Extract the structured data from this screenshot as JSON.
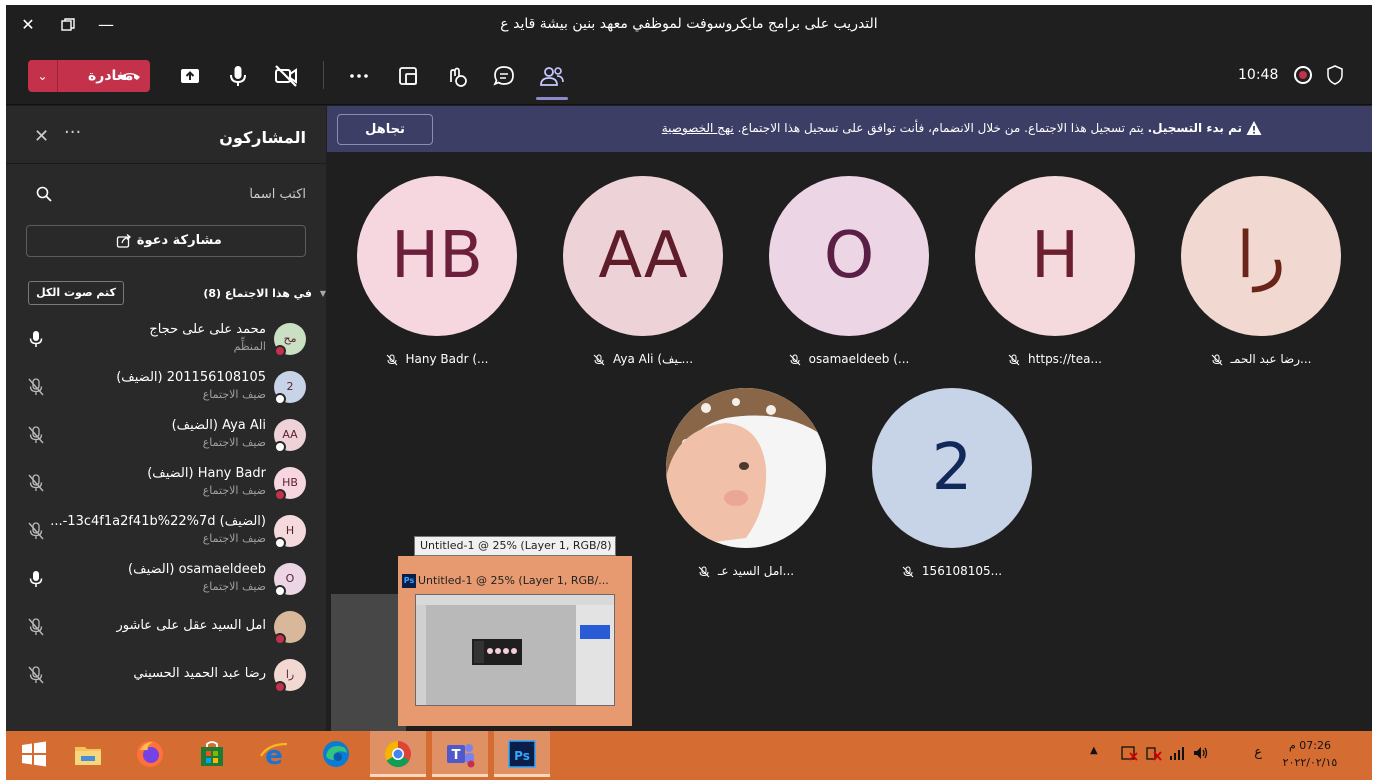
{
  "window": {
    "title": "التدريب على برامج مايكروسوفت لموظفي معهد بنين بيشة قايد ع"
  },
  "toolbar": {
    "leave_label": "مغادرة",
    "time": "10:48"
  },
  "panel": {
    "title": "المشاركون",
    "search_placeholder": "اكتب اسماً",
    "invite_label": "مشاركة دعوة",
    "section_label": "في هذا الاجتماع (8)",
    "mute_all_label": "كتم صوت الكل",
    "participants": [
      {
        "name": "محمد على على حجاج",
        "role": "المنظِّم",
        "initials": "مح",
        "avatar_color": "#c9e0c2",
        "presence": "busy",
        "mic": "on"
      },
      {
        "name": "201156108105 (الضيف)",
        "role": "ضيف الاجتماع",
        "initials": "2",
        "avatar_color": "#c7d3e6",
        "presence": "available",
        "mic": "off"
      },
      {
        "name": "Aya Ali (الضيف)",
        "role": "ضيف الاجتماع",
        "initials": "AA",
        "avatar_color": "#edd3d8",
        "presence": "available",
        "mic": "off"
      },
      {
        "name": "Hany Badr (الضيف)",
        "role": "ضيف الاجتماع",
        "initials": "HB",
        "avatar_color": "#f6d7e0",
        "presence": "busy",
        "mic": "off"
      },
      {
        "name": "(الضيف) 13c4f1a2f41b%22%7d-...",
        "role": "ضيف الاجتماع",
        "initials": "H",
        "avatar_color": "#f4dadd",
        "presence": "available",
        "mic": "off"
      },
      {
        "name": "osamaeldeeb (الضيف)",
        "role": "ضيف الاجتماع",
        "initials": "O",
        "avatar_color": "#ecd5e4",
        "presence": "available",
        "mic": "on"
      },
      {
        "name": "امل السيد عقل على عاشور",
        "role": "",
        "initials": "",
        "avatar_color": "#d8b79a",
        "presence": "busy",
        "mic": "off"
      },
      {
        "name": "رضا عبد الحميد الحسيني",
        "role": "",
        "initials": "را",
        "avatar_color": "#f1d9d2",
        "presence": "busy",
        "mic": "off"
      }
    ]
  },
  "banner": {
    "bold": "تم بدء التسجيل.",
    "text": "يتم تسجيل هذا الاجتماع. من خلال الانضمام، فأنت توافق على تسجيل هذا الاجتماع.",
    "link": "نهج الخصوصية",
    "dismiss_label": "تجاهل"
  },
  "stage": {
    "tiles": [
      {
        "initials": "را",
        "caption": "رضا عبد الحمـ...",
        "bg": "#f1d9d2",
        "fg": "#6a2418"
      },
      {
        "initials": "H",
        "caption": "https://tea...",
        "bg": "#f4dadd",
        "fg": "#6b1f2f"
      },
      {
        "initials": "O",
        "caption": "osamaeldeeb (...",
        "bg": "#ecd5e4",
        "fg": "#5a1f45"
      },
      {
        "initials": "AA",
        "caption": "Aya Ali (ـيف...",
        "bg": "#edd3d8",
        "fg": "#5f1d2a"
      },
      {
        "initials": "HB",
        "caption": "Hany Badr (...",
        "bg": "#f6d7e0",
        "fg": "#6b1f3a"
      },
      {
        "initials": "2",
        "caption": "156108105...",
        "bg": "#c7d3e6",
        "fg": "#10285a"
      },
      {
        "initials": "",
        "caption": "امل السيد عـ...",
        "bg": "#d8b79a",
        "fg": "#333333"
      }
    ]
  },
  "thumbnail": {
    "tooltip": "Untitled-1 @ 25% (Layer 1, RGB/8) *",
    "title": "Untitled-1 @ 25% (Layer 1, RGB/...",
    "app_icon": "Ps"
  },
  "taskbar": {
    "time": "07:26 م",
    "date": "٢٠٢٢/٠٢/١٥",
    "lang": "ع",
    "apps": [
      "start-icon",
      "file-explorer-icon",
      "firefox-icon",
      "store-icon",
      "ie-icon",
      "edge-icon",
      "chrome-icon",
      "teams-icon",
      "photoshop-icon"
    ]
  },
  "colors": {
    "leave": "#c4314b",
    "banner": "#3d3e66",
    "accent": "#8b8cc7",
    "taskbar": "#d56d32"
  }
}
